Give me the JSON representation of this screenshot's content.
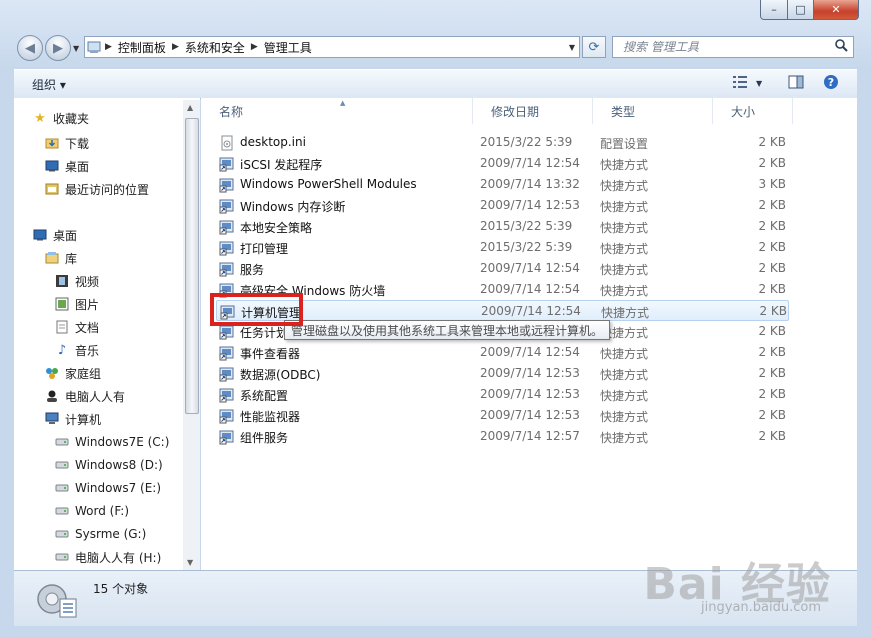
{
  "window": {
    "caption_buttons": [
      "–",
      "□",
      "✕"
    ]
  },
  "address": {
    "crumbs": [
      "控制面板",
      "系统和安全",
      "管理工具"
    ]
  },
  "search": {
    "placeholder": "搜索 管理工具"
  },
  "toolbar": {
    "organize_label": "组织 ▾"
  },
  "nav": {
    "items": [
      {
        "label": "收藏夹",
        "icon": "star-icon"
      },
      {
        "label": "下载",
        "icon": "downloads-folder-icon"
      },
      {
        "label": "桌面",
        "icon": "desktop-icon"
      },
      {
        "label": "最近访问的位置",
        "icon": "recent-places-icon"
      },
      {
        "label": "桌面",
        "icon": "desktop-icon"
      },
      {
        "label": "库",
        "icon": "library-icon"
      },
      {
        "label": "视频",
        "icon": "video-icon"
      },
      {
        "label": "图片",
        "icon": "pictures-icon"
      },
      {
        "label": "文档",
        "icon": "documents-icon"
      },
      {
        "label": "音乐",
        "icon": "music-icon"
      },
      {
        "label": "家庭组",
        "icon": "homegroup-icon"
      },
      {
        "label": "电脑人人有",
        "icon": "user-icon"
      },
      {
        "label": "计算机",
        "icon": "computer-icon"
      },
      {
        "label": "Windows7E (C:)",
        "icon": "drive-icon"
      },
      {
        "label": "Windows8 (D:)",
        "icon": "drive-icon"
      },
      {
        "label": "Windows7 (E:)",
        "icon": "drive-icon"
      },
      {
        "label": "Word (F:)",
        "icon": "drive-icon"
      },
      {
        "label": "Sysrme (G:)",
        "icon": "drive-icon"
      },
      {
        "label": "电脑人人有 (H:)",
        "icon": "drive-icon"
      }
    ]
  },
  "columns": {
    "name": "名称",
    "date": "修改日期",
    "type": "类型",
    "size": "大小"
  },
  "files": [
    {
      "name": "desktop.ini",
      "date": "2015/3/22 5:39",
      "type": "配置设置",
      "size": "2 KB",
      "icon": "ini-file-icon"
    },
    {
      "name": "iSCSI 发起程序",
      "date": "2009/7/14 12:54",
      "type": "快捷方式",
      "size": "2 KB",
      "icon": "shortcut-icon"
    },
    {
      "name": "Windows PowerShell Modules",
      "date": "2009/7/14 13:32",
      "type": "快捷方式",
      "size": "3 KB",
      "icon": "shortcut-icon"
    },
    {
      "name": "Windows 内存诊断",
      "date": "2009/7/14 12:53",
      "type": "快捷方式",
      "size": "2 KB",
      "icon": "shortcut-icon"
    },
    {
      "name": "本地安全策略",
      "date": "2015/3/22 5:39",
      "type": "快捷方式",
      "size": "2 KB",
      "icon": "shortcut-icon"
    },
    {
      "name": "打印管理",
      "date": "2015/3/22 5:39",
      "type": "快捷方式",
      "size": "2 KB",
      "icon": "shortcut-icon"
    },
    {
      "name": "服务",
      "date": "2009/7/14 12:54",
      "type": "快捷方式",
      "size": "2 KB",
      "icon": "shortcut-icon"
    },
    {
      "name": "高级安全 Windows 防火墙",
      "date": "2009/7/14 12:54",
      "type": "快捷方式",
      "size": "2 KB",
      "icon": "shortcut-icon"
    },
    {
      "name": "计算机管理",
      "date": "2009/7/14 12:54",
      "type": "快捷方式",
      "size": "2 KB",
      "icon": "shortcut-icon",
      "selected": true
    },
    {
      "name": "任务计划程序",
      "date": "2009/7/14 12:54",
      "type": "快捷方式",
      "size": "2 KB",
      "icon": "shortcut-icon"
    },
    {
      "name": "事件查看器",
      "date": "2009/7/14 12:54",
      "type": "快捷方式",
      "size": "2 KB",
      "icon": "shortcut-icon"
    },
    {
      "name": "数据源(ODBC)",
      "date": "2009/7/14 12:53",
      "type": "快捷方式",
      "size": "2 KB",
      "icon": "shortcut-icon"
    },
    {
      "name": "系统配置",
      "date": "2009/7/14 12:53",
      "type": "快捷方式",
      "size": "2 KB",
      "icon": "shortcut-icon"
    },
    {
      "name": "性能监视器",
      "date": "2009/7/14 12:53",
      "type": "快捷方式",
      "size": "2 KB",
      "icon": "shortcut-icon"
    },
    {
      "name": "组件服务",
      "date": "2009/7/14 12:57",
      "type": "快捷方式",
      "size": "2 KB",
      "icon": "shortcut-icon"
    }
  ],
  "tooltip": "管理磁盘以及使用其他系统工具来管理本地或远程计算机。",
  "status": {
    "count": "15 个对象"
  },
  "watermark": {
    "main": "Bai 经验",
    "sub": "jingyan.baidu.com"
  },
  "colors": {
    "highlight": "#d8231f",
    "selection_border": "#b6d2f0"
  }
}
